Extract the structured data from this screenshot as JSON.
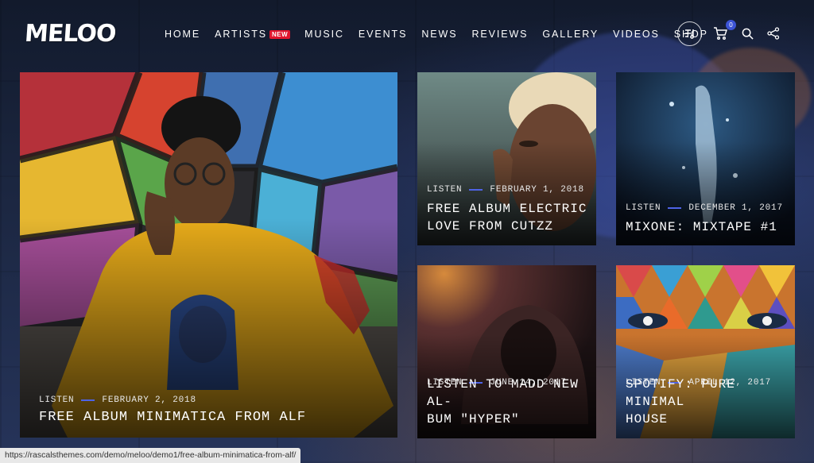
{
  "brand": {
    "logo_text": "MELOO"
  },
  "nav": {
    "items": [
      {
        "label": "HOME"
      },
      {
        "label": "ARTISTS",
        "badge": "NEW"
      },
      {
        "label": "MUSIC"
      },
      {
        "label": "EVENTS"
      },
      {
        "label": "NEWS"
      },
      {
        "label": "REVIEWS"
      },
      {
        "label": "GALLERY"
      },
      {
        "label": "VIDEOS"
      },
      {
        "label": "SHOP"
      }
    ]
  },
  "tools": {
    "cart_count": "0",
    "icons": [
      "playlist-icon",
      "cart-icon",
      "search-icon",
      "share-icon"
    ]
  },
  "colors": {
    "accent": "#4e63e6",
    "badge": "#e0152d",
    "cart_badge": "#3c54d6"
  },
  "posts": [
    {
      "category": "LISTEN",
      "date": "FEBRUARY 2, 2018",
      "title": "FREE ALBUM MINIMATICA FROM ALF"
    },
    {
      "category": "LISTEN",
      "date": "FEBRUARY 1, 2018",
      "title_line1": "FREE ALBUM ELECTRIC",
      "title_line2": "LOVE FROM CUTZZ"
    },
    {
      "category": "LISTEN",
      "date": "DECEMBER 1, 2017",
      "title": "MIXONE: MIXTAPE #1"
    },
    {
      "category": "LISTEN",
      "date": "JUNE 14, 2017",
      "title_line1": "LISTEN TO MADD NEW AL-",
      "title_line2": "BUM \"HYPER\""
    },
    {
      "category": "LISTEN",
      "date": "APRIL 12, 2017",
      "title_line1": "SPOTIFY: PURE MINIMAL",
      "title_line2": "HOUSE"
    }
  ],
  "status_bar": {
    "url": "https://rascalsthemes.com/demo/meloo/demo1/free-album-minimatica-from-alf/"
  }
}
